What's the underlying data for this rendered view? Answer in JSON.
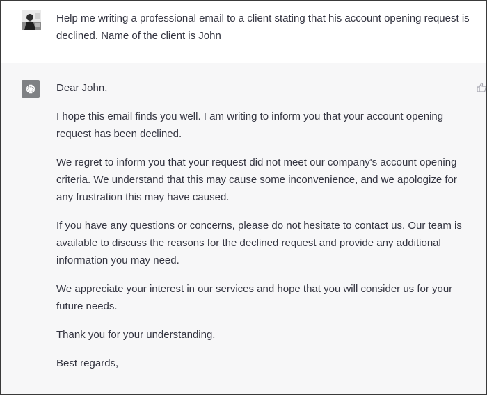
{
  "user_message": {
    "avatar_icon": "user-avatar",
    "text": "Help me writing a professional email to a client stating that his account opening request is declined. Name of the client is John"
  },
  "assistant_message": {
    "avatar_icon": "openai-logo-icon",
    "paragraphs": [
      "Dear John,",
      "I hope this email finds you well. I am writing to inform you that your account opening request has been declined.",
      "We regret to inform you that your request did not meet our company's account opening criteria. We understand that this may cause some inconvenience, and we apologize for any frustration this may have caused.",
      "If you have any questions or concerns, please do not hesitate to contact us. Our team is available to discuss the reasons for the declined request and provide any additional information you may need.",
      "We appreciate your interest in our services and hope that you will consider us for your future needs.",
      "Thank you for your understanding.",
      "Best regards,"
    ],
    "feedback_icon": "thumbs-up-icon"
  },
  "colors": {
    "assistant_bg": "#f7f7f8",
    "text": "#343541",
    "avatar_bg": "#7f8184"
  }
}
